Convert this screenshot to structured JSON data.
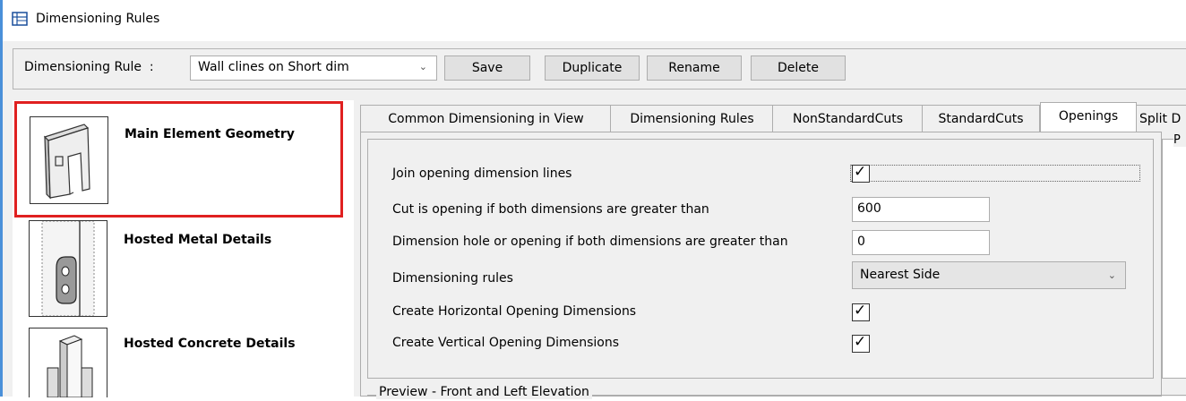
{
  "window": {
    "title": "Dimensioning Rules",
    "icon": "dimension-grid-icon",
    "edge_color": "#4a90d9"
  },
  "toolbar": {
    "rule_label": "Dimensioning Rule",
    "rule_separator": ":",
    "rule_value": "Wall clines on Short dim",
    "save_label": "Save",
    "duplicate_label": "Duplicate",
    "rename_label": "Rename",
    "delete_label": "Delete"
  },
  "categories": [
    {
      "label": "Main Element Geometry",
      "highlighted": true,
      "icon": "wall-panel-icon"
    },
    {
      "label": "Hosted Metal Details",
      "highlighted": false,
      "icon": "metal-bracket-icon"
    },
    {
      "label": "Hosted Concrete Details",
      "highlighted": false,
      "icon": "concrete-block-icon"
    }
  ],
  "tabs": [
    {
      "label": "Common Dimensioning in View"
    },
    {
      "label": "Dimensioning Rules"
    },
    {
      "label": "NonStandardCuts"
    },
    {
      "label": "StandardCuts"
    },
    {
      "label": "Openings",
      "active": true
    },
    {
      "label": "Split D"
    }
  ],
  "openings": {
    "join_label": "Join opening dimension lines",
    "join_checked": true,
    "cut_label": "Cut is opening if both dimensions are greater than",
    "cut_value": "600",
    "hole_label": "Dimension hole or opening if both dimensions are greater than",
    "hole_value": "0",
    "rules_label": "Dimensioning rules",
    "rules_value": "Nearest Side",
    "horizontal_label": "Create Horizontal Opening Dimensions",
    "horizontal_checked": true,
    "vertical_label": "Create Vertical Opening Dimensions",
    "vertical_checked": true
  },
  "preview": {
    "label": "Preview - Front and Left Elevation",
    "side_label": "P"
  },
  "check_mark": "✓",
  "highlight_color": "#e02020"
}
